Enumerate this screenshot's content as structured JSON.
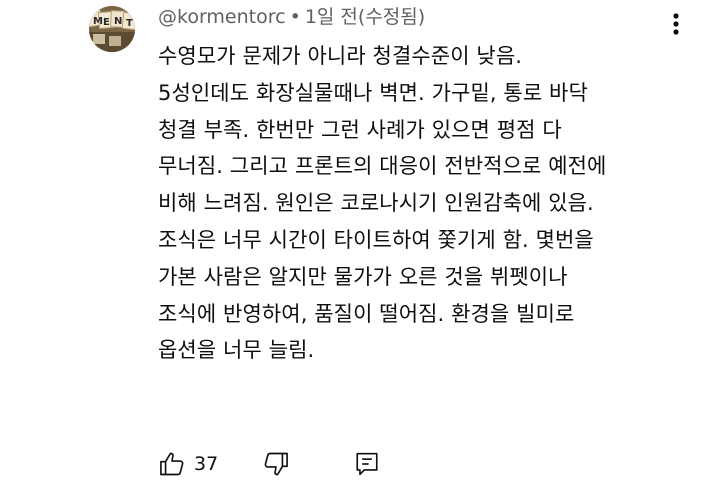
{
  "comment": {
    "author": "@kormentorc",
    "separator": "•",
    "timestamp": "1일 전(수정됨)",
    "avatar_text": [
      "M",
      "E",
      "N",
      "T"
    ],
    "lines": [
      "수영모가 문제가 아니라 청결수준이 낮음.",
      "5성인데도 화장실물때나 벽면. 가구밑, 통로 바닥",
      "청결 부족. 한번만 그런 사례가 있으면 평점 다",
      "무너짐. 그리고 프론트의 대응이 전반적으로 예전에",
      "비해 느려짐. 원인은 코로나시기 인원감축에 있음.",
      "조식은 너무 시간이 타이트하여 쫓기게 함. 몇번을",
      "가본 사람은 알지만 물가가 오른 것을 뷔펫이나",
      "조식에 반영하여, 품질이 떨어짐. 환경을 빌미로",
      "옵션을 너무 늘림."
    ],
    "likes": "37"
  },
  "icons": {
    "more": "more-vert-icon",
    "like": "thumb-up-icon",
    "dislike": "thumb-down-icon",
    "reply": "reply-icon"
  },
  "colors": {
    "meta_text": "#606060",
    "body_text": "#0f0f0f"
  }
}
